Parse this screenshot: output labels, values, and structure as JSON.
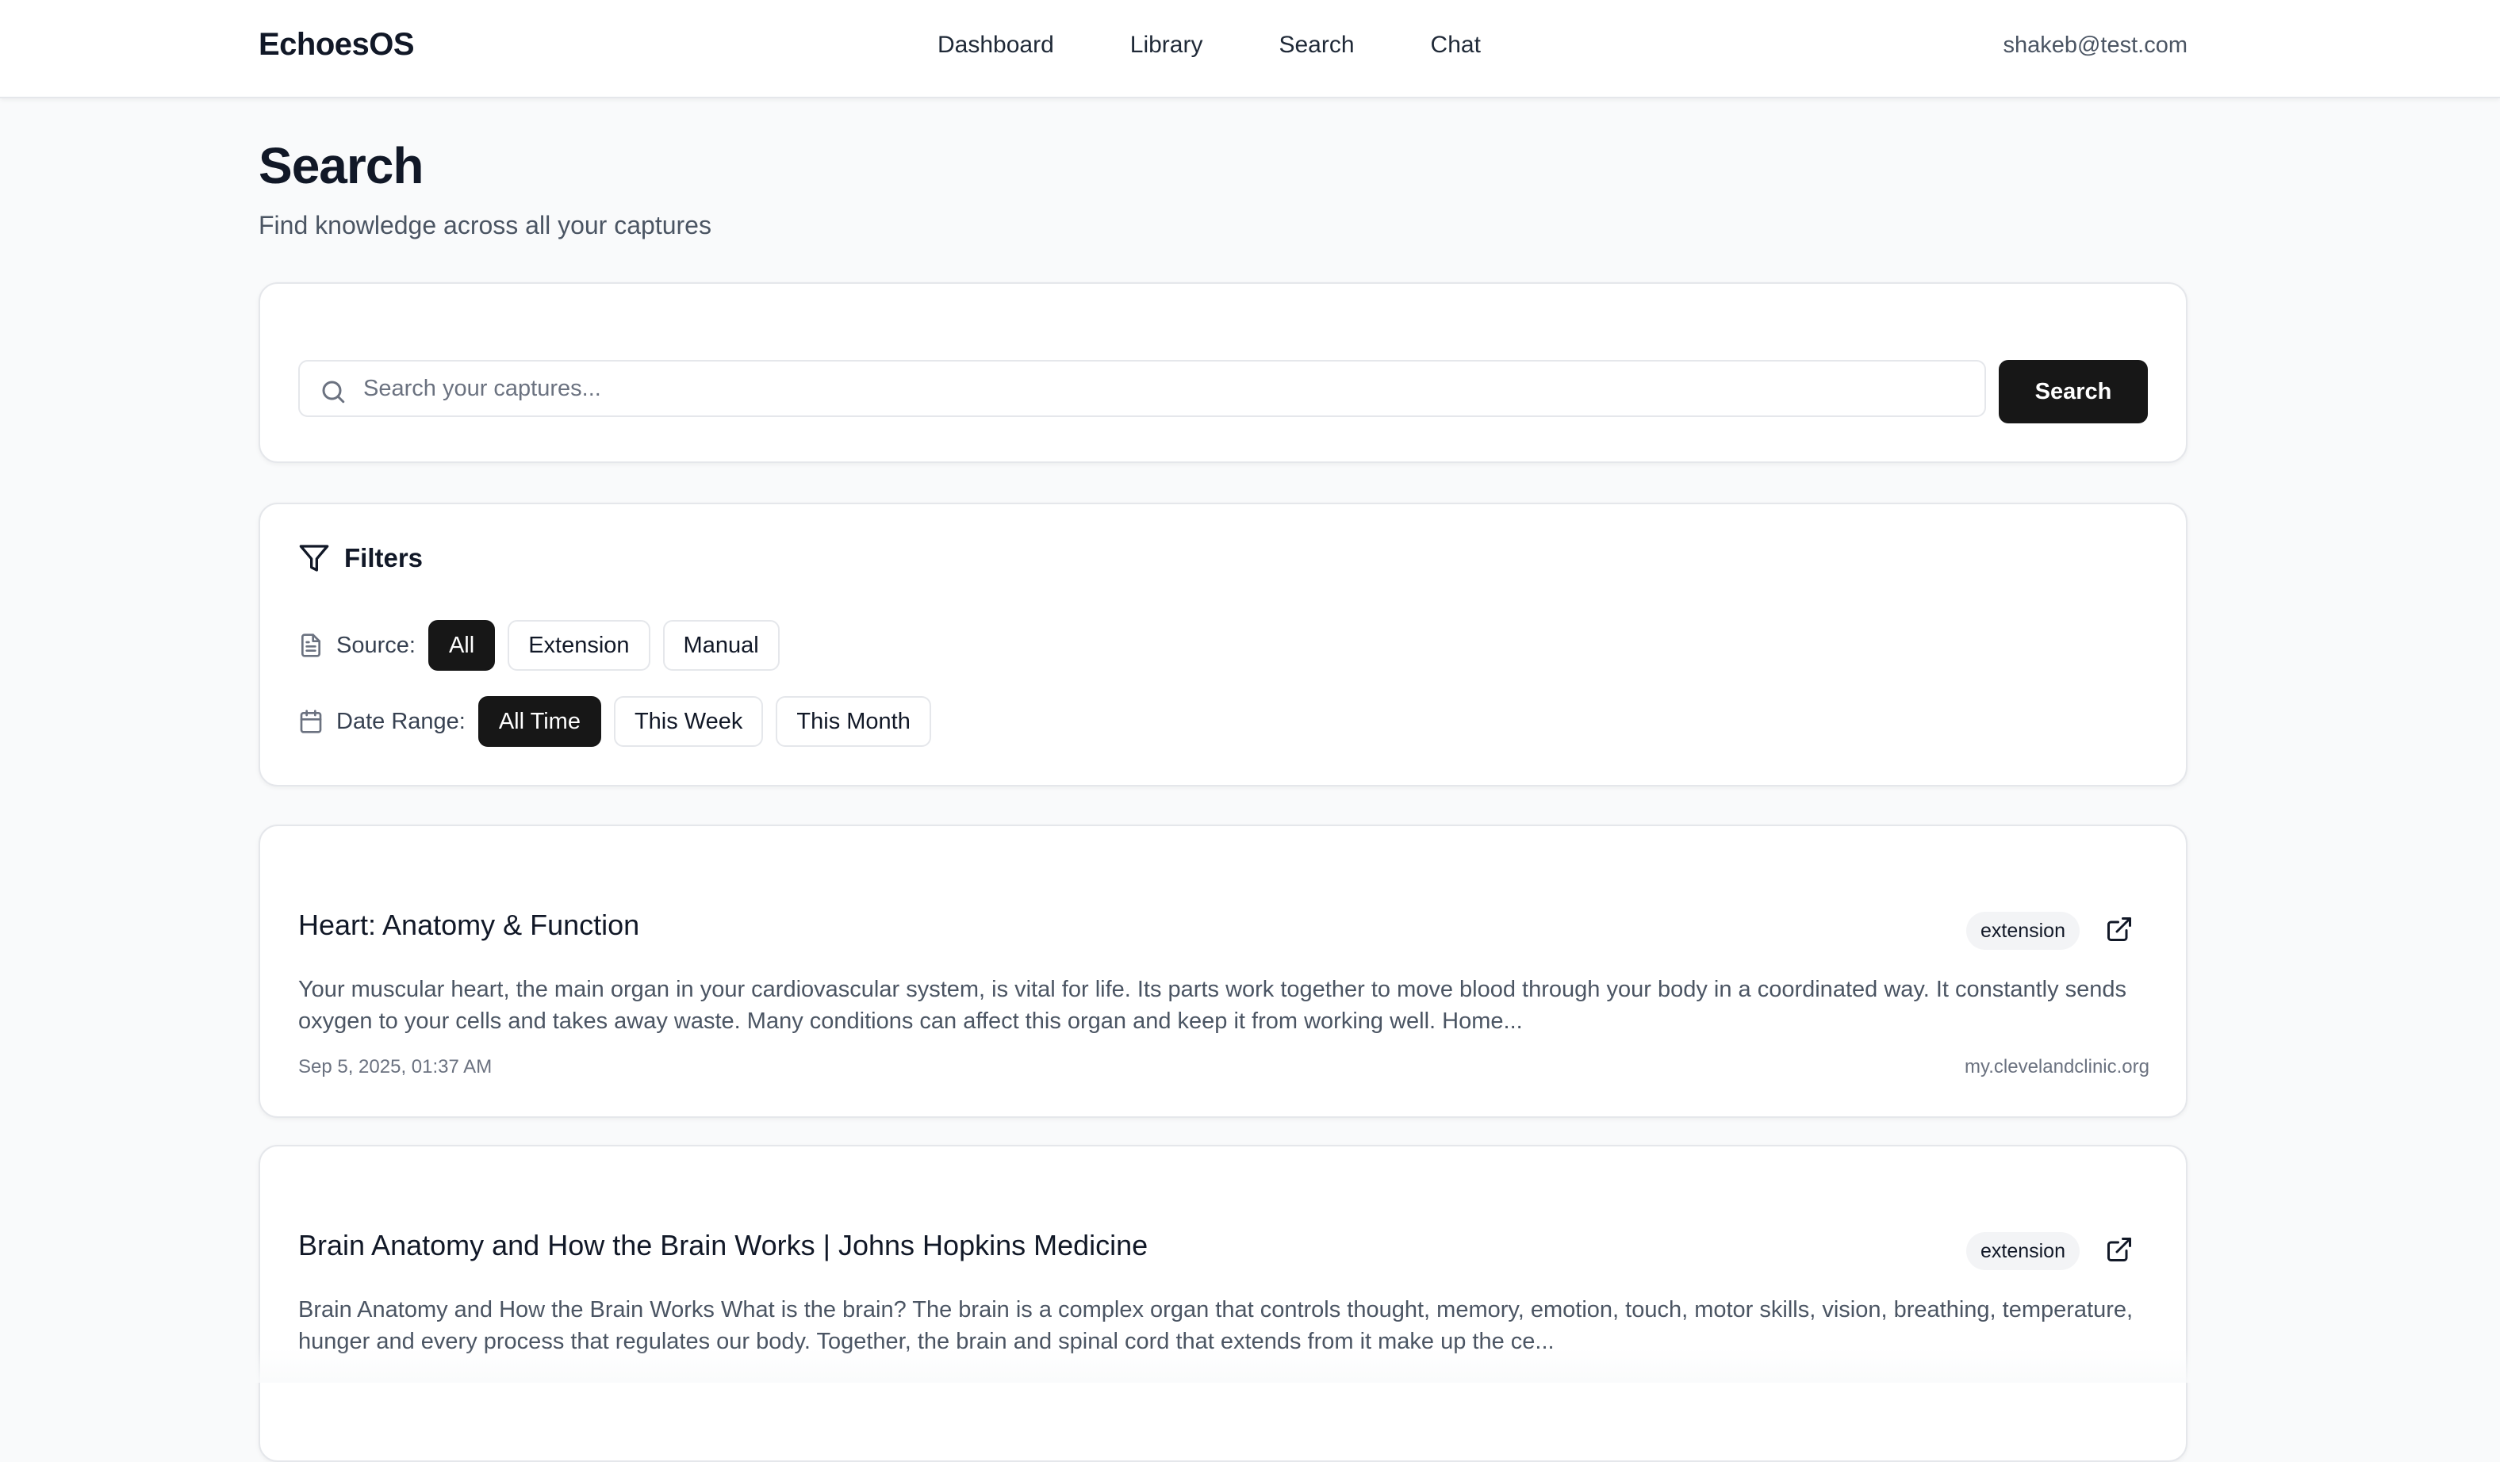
{
  "app": {
    "brand": "EchoesOS",
    "user_email": "shakeb@test.com"
  },
  "nav": {
    "items": [
      {
        "label": "Dashboard"
      },
      {
        "label": "Library"
      },
      {
        "label": "Search"
      },
      {
        "label": "Chat"
      }
    ]
  },
  "header": {
    "title": "Search",
    "subtitle": "Find knowledge across all your captures"
  },
  "search": {
    "placeholder": "Search your captures...",
    "value": "",
    "button_label": "Search"
  },
  "filters": {
    "title": "Filters",
    "source": {
      "label": "Source:",
      "options": [
        {
          "label": "All",
          "selected": true
        },
        {
          "label": "Extension",
          "selected": false
        },
        {
          "label": "Manual",
          "selected": false
        }
      ]
    },
    "date_range": {
      "label": "Date Range:",
      "options": [
        {
          "label": "All Time",
          "selected": true
        },
        {
          "label": "This Week",
          "selected": false
        },
        {
          "label": "This Month",
          "selected": false
        }
      ]
    }
  },
  "results": [
    {
      "title": "Heart: Anatomy & Function",
      "badge": "extension",
      "snippet": "Your muscular heart, the main organ in your cardiovascular system, is vital for life. Its parts work together to move blood through your body in a coordinated way. It constantly sends oxygen to your cells and takes away waste. Many conditions can affect this organ and keep it from working well. Home...",
      "date": "Sep 5, 2025, 01:37 AM",
      "domain": "my.clevelandclinic.org"
    },
    {
      "title": "Brain Anatomy and How the Brain Works | Johns Hopkins Medicine",
      "badge": "extension",
      "snippet": "Brain Anatomy and How the Brain Works What is the brain? The brain is a complex organ that controls thought, memory, emotion, touch, motor skills, vision, breathing, temperature, hunger and every process that regulates our body. Together, the brain and spinal cord that extends from it make up the ce...",
      "date": "",
      "domain": ""
    }
  ],
  "colors": {
    "page_bg": "#f9fafb",
    "card_bg": "#ffffff",
    "primary_button": "#171717",
    "border": "#e5e7eb",
    "muted_text": "#4b5563"
  },
  "icons": {
    "search": "search-icon",
    "filter": "filter-icon",
    "source": "file-text-icon",
    "date": "calendar-icon",
    "open_link": "external-link-icon"
  }
}
